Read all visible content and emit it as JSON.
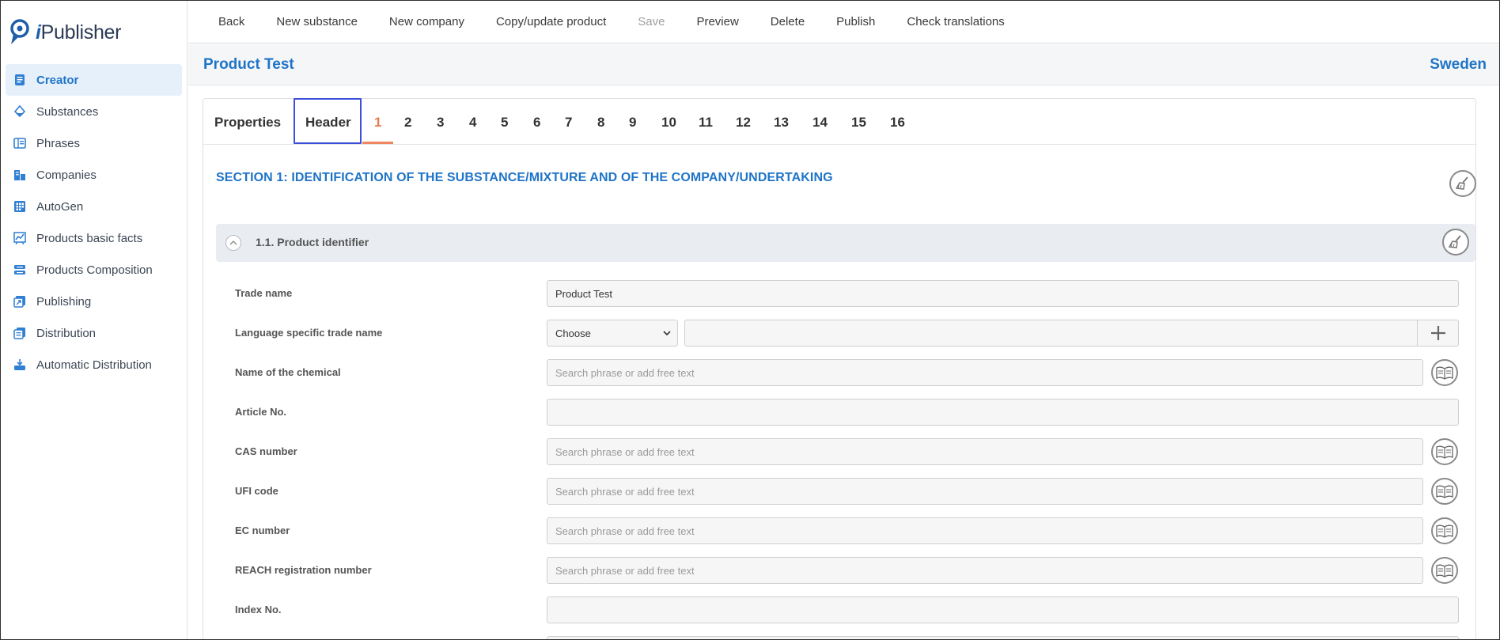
{
  "app": {
    "name_prefix": "i",
    "name_rest": "Publisher"
  },
  "sidebar": {
    "items": [
      {
        "label": "Creator",
        "icon": "creator-icon",
        "active": true
      },
      {
        "label": "Substances",
        "icon": "substances-icon"
      },
      {
        "label": "Phrases",
        "icon": "phrases-icon"
      },
      {
        "label": "Companies",
        "icon": "companies-icon"
      },
      {
        "label": "AutoGen",
        "icon": "autogen-icon"
      },
      {
        "label": "Products basic facts",
        "icon": "chart-icon"
      },
      {
        "label": "Products Composition",
        "icon": "composition-icon"
      },
      {
        "label": "Publishing",
        "icon": "publishing-icon"
      },
      {
        "label": "Distribution",
        "icon": "distribution-icon"
      },
      {
        "label": "Automatic Distribution",
        "icon": "auto-distribution-icon"
      }
    ]
  },
  "toolbar": {
    "back": "Back",
    "new_substance": "New substance",
    "new_company": "New company",
    "copy_update": "Copy/update product",
    "save": "Save",
    "preview": "Preview",
    "delete": "Delete",
    "publish": "Publish",
    "check_translations": "Check translations"
  },
  "titlebar": {
    "product": "Product Test",
    "country": "Sweden"
  },
  "tabs": {
    "properties": "Properties",
    "header": "Header",
    "sections": [
      "1",
      "2",
      "3",
      "4",
      "5",
      "6",
      "7",
      "8",
      "9",
      "10",
      "11",
      "12",
      "13",
      "14",
      "15",
      "16"
    ],
    "active_section": "1"
  },
  "section": {
    "title": "SECTION 1: IDENTIFICATION OF THE SUBSTANCE/MIXTURE AND OF THE COMPANY/UNDERTAKING",
    "subsection_title": "1.1. Product identifier"
  },
  "form": {
    "trade_name": {
      "label": "Trade name",
      "value": "Product Test"
    },
    "lang_trade_name": {
      "label": "Language specific trade name",
      "select": "Choose",
      "value": ""
    },
    "chemical_name": {
      "label": "Name of the chemical",
      "placeholder": "Search phrase or add free text"
    },
    "article_no": {
      "label": "Article No.",
      "value": ""
    },
    "cas_number": {
      "label": "CAS number",
      "placeholder": "Search phrase or add free text"
    },
    "ufi_code": {
      "label": "UFI code",
      "placeholder": "Search phrase or add free text"
    },
    "ec_number": {
      "label": "EC number",
      "placeholder": "Search phrase or add free text"
    },
    "reach_number": {
      "label": "REACH registration number",
      "placeholder": "Search phrase or add free text"
    },
    "index_no": {
      "label": "Index No.",
      "value": ""
    }
  },
  "colors": {
    "accent": "#1f74c7",
    "active_tab": "#e87a4f",
    "highlight": "#3b4fd8"
  }
}
